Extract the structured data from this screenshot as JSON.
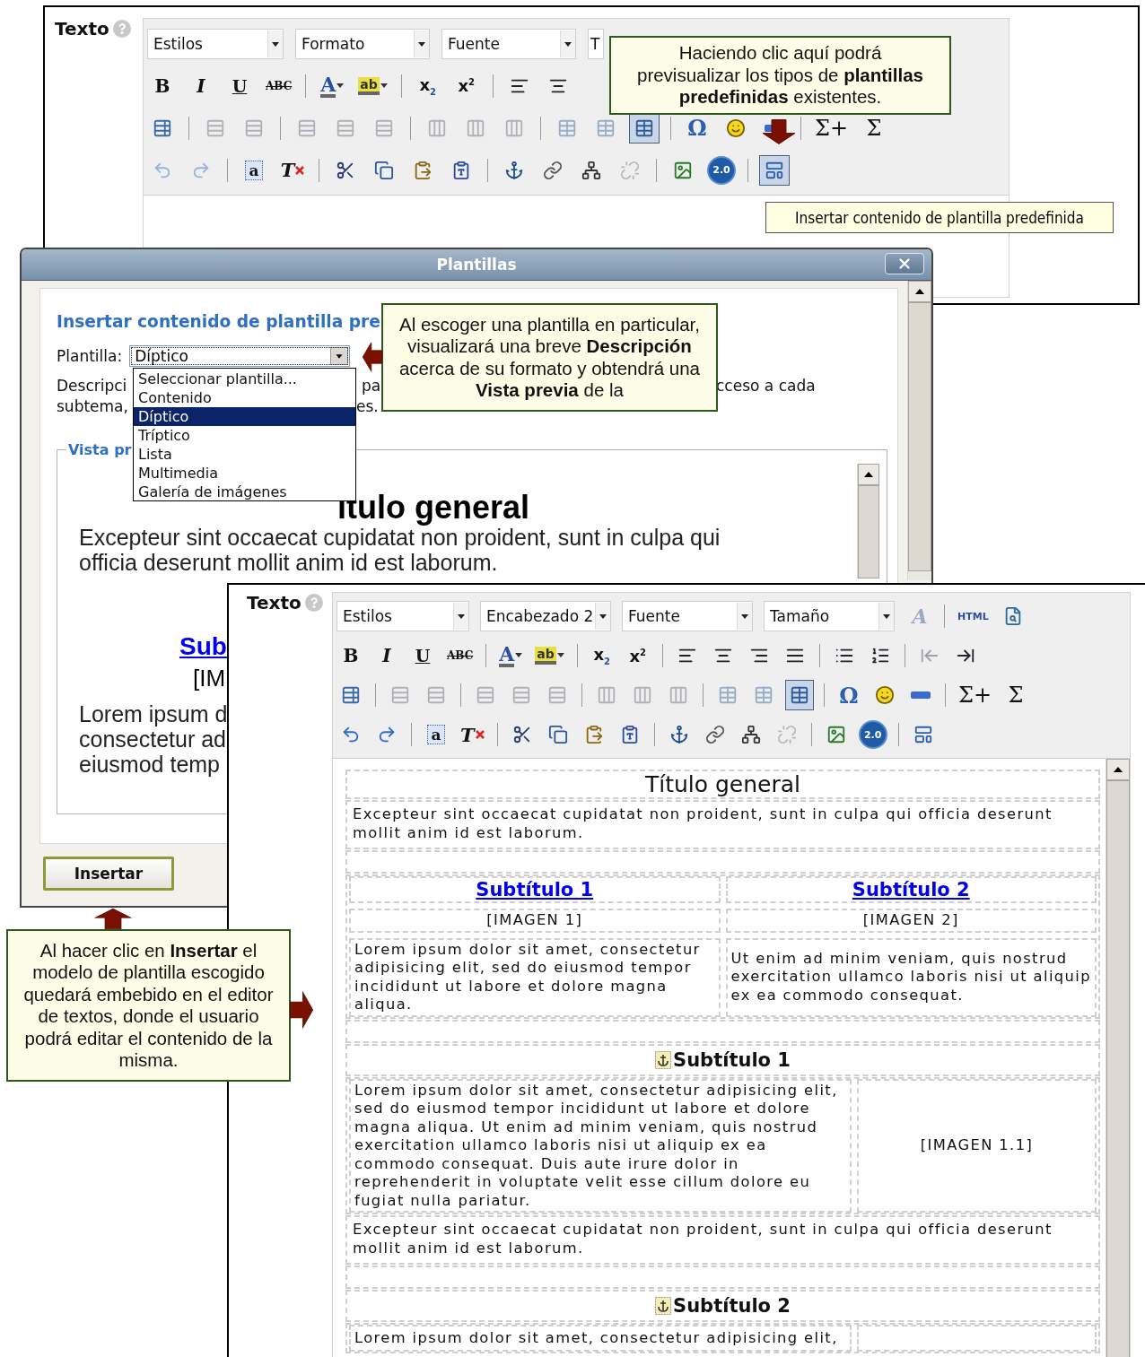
{
  "top_editor": {
    "label": "Texto",
    "selects": [
      "Estilos",
      "Formato",
      "Fuente",
      "T"
    ],
    "toolbar": [
      [
        [
          {
            "kind": "bold",
            "label": "B",
            "disabled": false,
            "active": false
          },
          {
            "kind": "italic",
            "label": "I",
            "disabled": false,
            "active": false
          },
          {
            "kind": "underline",
            "label": "U",
            "disabled": false,
            "active": false
          },
          {
            "kind": "strike",
            "label": "ABC",
            "disabled": false,
            "active": false
          }
        ],
        [
          {
            "kind": "textcolor",
            "label": "A",
            "disabled": false,
            "active": false
          },
          {
            "kind": "bgcolor",
            "label": "ab",
            "disabled": false,
            "active": false
          }
        ],
        [
          {
            "kind": "sub",
            "label": "x$_{2}$",
            "disabled": false,
            "active": false
          },
          {
            "kind": "sup",
            "label": "x$^{2}$",
            "disabled": false,
            "active": false
          }
        ],
        [
          {
            "kind": "alignleft",
            "disabled": false,
            "active": false
          },
          {
            "kind": "aligncenter",
            "disabled": false,
            "active": false
          }
        ]
      ],
      [
        [
          {
            "kind": "tableprops",
            "disabled": false,
            "active": false
          }
        ],
        [
          {
            "kind": "cell",
            "disabled": true,
            "active": false
          },
          {
            "kind": "cell",
            "disabled": true,
            "active": false
          }
        ],
        [
          {
            "kind": "row",
            "disabled": true,
            "active": false
          },
          {
            "kind": "row",
            "disabled": true,
            "active": false
          },
          {
            "kind": "row",
            "disabled": true,
            "active": false
          }
        ],
        [
          {
            "kind": "col",
            "disabled": true,
            "active": false
          },
          {
            "kind": "col",
            "disabled": true,
            "active": false
          },
          {
            "kind": "col",
            "disabled": true,
            "active": false
          }
        ],
        [
          {
            "kind": "table",
            "disabled": true,
            "active": false
          },
          {
            "kind": "table",
            "disabled": true,
            "active": false
          },
          {
            "kind": "table",
            "disabled": false,
            "active": true
          }
        ],
        [
          {
            "kind": "omega",
            "label": "Ω",
            "disabled": false,
            "active": false
          },
          {
            "kind": "smiley",
            "disabled": false,
            "active": false
          },
          {
            "kind": "hr",
            "disabled": false,
            "active": false
          }
        ],
        [
          {
            "kind": "sigmaplus",
            "label": "Σ+",
            "disabled": false,
            "active": false
          },
          {
            "kind": "sigma",
            "label": "Σ",
            "disabled": false,
            "active": false
          }
        ]
      ],
      [
        [
          {
            "kind": "undo",
            "disabled": true,
            "active": false
          },
          {
            "kind": "redo",
            "disabled": true,
            "active": false
          }
        ],
        [
          {
            "kind": "selectall",
            "label": "a",
            "disabled": false,
            "active": false
          },
          {
            "kind": "removeformat",
            "label": "T",
            "disabled": false,
            "active": false
          }
        ],
        [
          {
            "kind": "cut",
            "disabled": false,
            "active": false
          },
          {
            "kind": "copy",
            "disabled": false,
            "active": false
          },
          {
            "kind": "paste",
            "disabled": false,
            "active": false
          },
          {
            "kind": "pasteword",
            "disabled": false,
            "active": false
          }
        ],
        [
          {
            "kind": "anchor",
            "disabled": false,
            "active": false
          },
          {
            "kind": "link",
            "disabled": false,
            "active": false
          },
          {
            "kind": "sitemap",
            "disabled": false,
            "active": false
          },
          {
            "kind": "unlink",
            "disabled": true,
            "active": false
          }
        ],
        [
          {
            "kind": "image",
            "disabled": false,
            "active": false
          },
          {
            "kind": "badge",
            "label": "2.0",
            "disabled": false,
            "active": false
          }
        ],
        [
          {
            "kind": "template",
            "disabled": false,
            "active": true
          }
        ]
      ]
    ],
    "tooltip": "Insertar contenido de plantilla predefinida"
  },
  "callouts": [
    {
      "text": "Haciendo clic aquí podrá previsualizar los tipos de **plantillas predefinidas** existentes."
    },
    {
      "text": "Al escoger una plantilla en particular, visualizará una breve **Descripción** acerca de su formato y obtendrá una **Vista previa** de la"
    },
    {
      "text": "Al hacer clic en **Insertar** el modelo de plantilla escogido quedará embebido en el editor de textos, donde el usuario podrá editar el contenido de la misma."
    }
  ],
  "dialog": {
    "title": "Plantillas",
    "heading": "Insertar contenido de plantilla pre",
    "template_label": "Plantilla:",
    "template_value": "Díptico",
    "options": [
      {
        "label": "Seleccionar plantilla...",
        "selected": false
      },
      {
        "label": "Contenido",
        "selected": false
      },
      {
        "label": "Díptico",
        "selected": true
      },
      {
        "label": "Tríptico",
        "selected": false
      },
      {
        "label": "Lista",
        "selected": false
      },
      {
        "label": "Multimedia",
        "selected": false
      },
      {
        "label": "Galería de imágenes",
        "selected": false
      }
    ],
    "description": [
      [
        "Descripci",
        "pa",
        "cceso a cada"
      ],
      [
        "subtema,",
        "es."
      ]
    ],
    "preview_legend": "Vista pr",
    "preview": {
      "title": "ítulo general",
      "paragraph_lines": [
        "Excepteur sint occaecat cupidatat non proident, sunt in culpa qui",
        "officia deserunt mollit anim id est laborum."
      ],
      "subtitle": "Sub",
      "image": "[IM",
      "text_lines": [
        "Lorem ipsum d",
        "consectetur ad",
        "eiusmod temp"
      ]
    },
    "button": "Insertar"
  },
  "bottom_editor": {
    "label": "Texto",
    "selects": [
      "Estilos",
      "Encabezado 2",
      "Fuente",
      "Tamaño"
    ],
    "select_tools": [
      [
        {
          "kind": "fontstyle",
          "label": "A",
          "disabled": true,
          "active": false
        }
      ],
      [
        {
          "kind": "html",
          "label": "HTML",
          "disabled": false,
          "active": false
        },
        {
          "kind": "preview",
          "disabled": false,
          "active": false
        }
      ]
    ],
    "toolbar": [
      [
        [
          {
            "kind": "bold",
            "label": "B",
            "disabled": false,
            "active": false
          },
          {
            "kind": "italic",
            "label": "I",
            "disabled": false,
            "active": false
          },
          {
            "kind": "underline",
            "label": "U",
            "disabled": false,
            "active": false
          },
          {
            "kind": "strike",
            "label": "ABC",
            "disabled": false,
            "active": false
          }
        ],
        [
          {
            "kind": "textcolor",
            "label": "A",
            "disabled": false,
            "active": false
          },
          {
            "kind": "bgcolor",
            "label": "ab",
            "disabled": false,
            "active": false
          }
        ],
        [
          {
            "kind": "sub",
            "label": "x$_{2}$",
            "disabled": false,
            "active": false
          },
          {
            "kind": "sup",
            "label": "x$^{2}$",
            "disabled": false,
            "active": false
          }
        ],
        [
          {
            "kind": "alignleft",
            "disabled": false,
            "active": false
          },
          {
            "kind": "aligncenter",
            "disabled": false,
            "active": false
          },
          {
            "kind": "alignright",
            "disabled": false,
            "active": false
          },
          {
            "kind": "justify",
            "disabled": false,
            "active": false
          }
        ],
        [
          {
            "kind": "bullets",
            "disabled": false,
            "active": false
          },
          {
            "kind": "numbers",
            "disabled": false,
            "active": false
          }
        ],
        [
          {
            "kind": "outdent",
            "disabled": true,
            "active": false
          },
          {
            "kind": "indent",
            "disabled": false,
            "active": false
          }
        ]
      ],
      [
        [
          {
            "kind": "tableprops",
            "disabled": false,
            "active": false
          }
        ],
        [
          {
            "kind": "cell",
            "disabled": true,
            "active": false
          },
          {
            "kind": "cell",
            "disabled": true,
            "active": false
          }
        ],
        [
          {
            "kind": "row",
            "disabled": true,
            "active": false
          },
          {
            "kind": "row",
            "disabled": true,
            "active": false
          },
          {
            "kind": "row",
            "disabled": true,
            "active": false
          }
        ],
        [
          {
            "kind": "col",
            "disabled": true,
            "active": false
          },
          {
            "kind": "col",
            "disabled": true,
            "active": false
          },
          {
            "kind": "col",
            "disabled": true,
            "active": false
          }
        ],
        [
          {
            "kind": "table",
            "disabled": true,
            "active": false
          },
          {
            "kind": "table",
            "disabled": true,
            "active": false
          },
          {
            "kind": "table",
            "disabled": false,
            "active": true
          }
        ],
        [
          {
            "kind": "omega",
            "label": "Ω",
            "disabled": false,
            "active": false
          },
          {
            "kind": "smiley",
            "disabled": false,
            "active": false
          },
          {
            "kind": "hr",
            "disabled": false,
            "active": false
          }
        ],
        [
          {
            "kind": "sigmaplus",
            "label": "Σ+",
            "disabled": false,
            "active": false
          },
          {
            "kind": "sigma",
            "label": "Σ",
            "disabled": false,
            "active": false
          }
        ]
      ],
      [
        [
          {
            "kind": "undo",
            "disabled": false,
            "active": false
          },
          {
            "kind": "redo",
            "disabled": false,
            "active": false
          }
        ],
        [
          {
            "kind": "selectall",
            "label": "a",
            "disabled": false,
            "active": false
          },
          {
            "kind": "removeformat",
            "label": "T",
            "disabled": false,
            "active": false
          }
        ],
        [
          {
            "kind": "cut",
            "disabled": false,
            "active": false
          },
          {
            "kind": "copy",
            "disabled": false,
            "active": false
          },
          {
            "kind": "paste",
            "disabled": false,
            "active": false
          },
          {
            "kind": "pasteword",
            "disabled": false,
            "active": false
          }
        ],
        [
          {
            "kind": "anchor",
            "disabled": false,
            "active": false
          },
          {
            "kind": "link",
            "disabled": false,
            "active": false
          },
          {
            "kind": "sitemap",
            "disabled": false,
            "active": false
          },
          {
            "kind": "unlink",
            "disabled": true,
            "active": false
          }
        ],
        [
          {
            "kind": "image",
            "disabled": false,
            "active": false
          },
          {
            "kind": "badge",
            "label": "2.0",
            "disabled": false,
            "active": false
          }
        ],
        [
          {
            "kind": "template",
            "disabled": false,
            "active": false
          }
        ]
      ]
    ],
    "document": {
      "title": "Título general",
      "intro": "Excepteur sint occaecat cupidatat non proident, sunt in culpa qui officia deserunt mollit anim id est laborum.",
      "columns": [
        {
          "subtitle": "Subtítulo 1",
          "image": "[IMAGEN 1]",
          "text": "Lorem ipsum dolor sit amet, consectetur adipisicing elit, sed do eiusmod tempor incididunt ut labore et dolore magna aliqua."
        },
        {
          "subtitle": "Subtítulo 2",
          "image": "[IMAGEN 2]",
          "text": "Ut enim ad minim veniam, quis nostrud exercitation ullamco laboris nisi ut aliquip ex ea commodo consequat."
        }
      ],
      "sections": [
        {
          "heading": "Subtítulo 1",
          "text": "Lorem ipsum dolor sit amet, consectetur adipisicing elit, sed do eiusmod tempor incididunt ut labore et dolore magna aliqua. Ut enim ad minim veniam, quis nostrud exercitation ullamco laboris nisi ut aliquip ex ea commodo consequat. Duis aute irure dolor in reprehenderit in voluptate velit esse cillum dolore eu fugiat nulla pariatur.",
          "image": "[IMAGEN 1.1]",
          "outro": "Excepteur sint occaecat cupidatat non proident, sunt in culpa qui officia deserunt mollit anim id est laborum."
        },
        {
          "heading": "Subtítulo 2",
          "text": "Lorem ipsum dolor sit amet, consectetur adipisicing elit,"
        }
      ]
    }
  }
}
